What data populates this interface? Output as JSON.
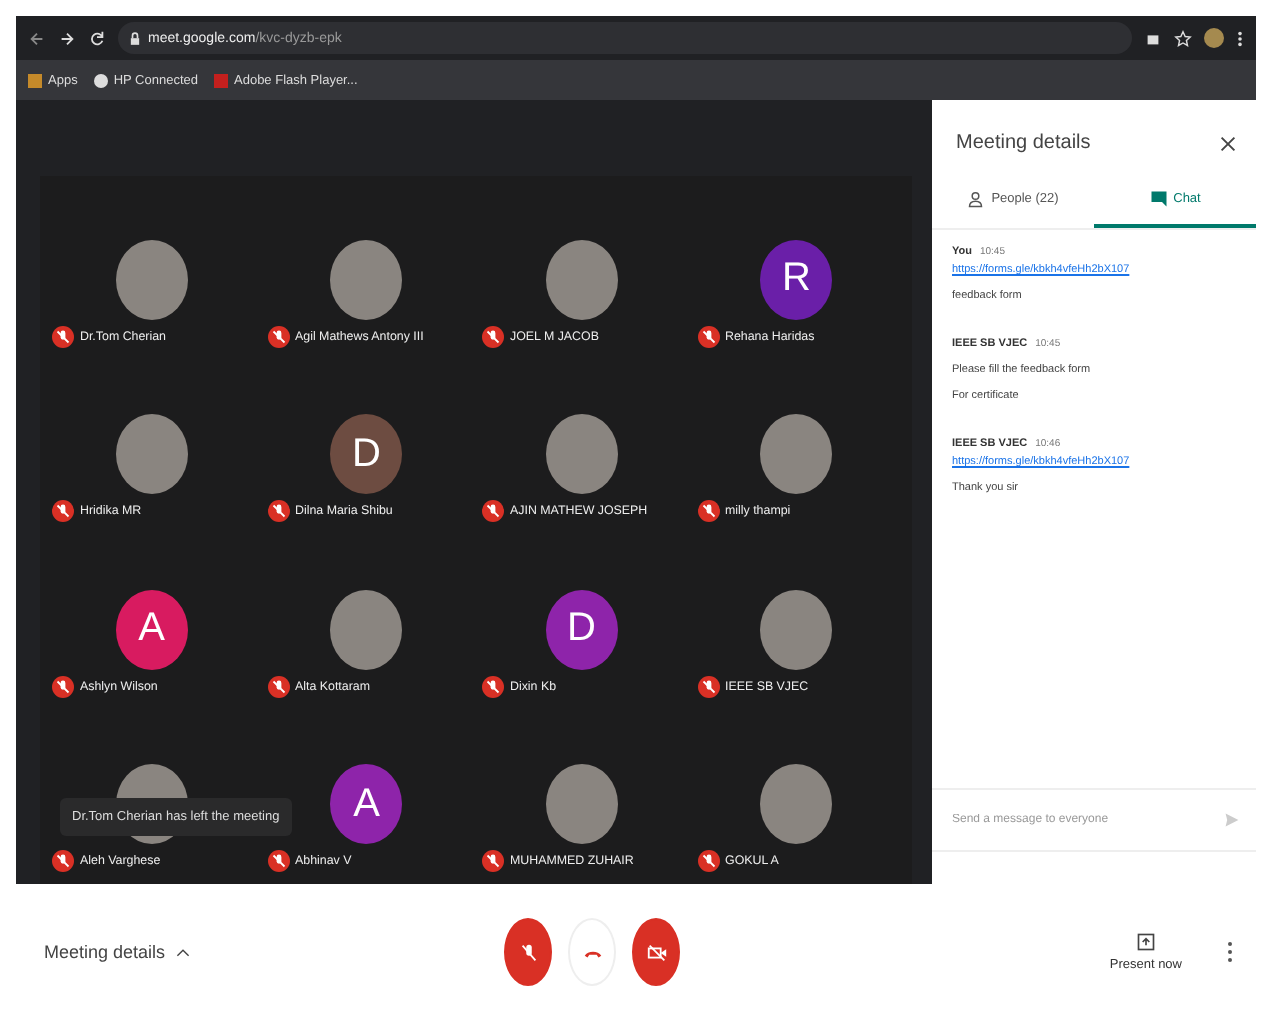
{
  "browser": {
    "url_host": "meet.google.com",
    "url_path": "/kvc-dyzb-epk",
    "bookmarks": [
      "Apps",
      "HP Connected",
      "Adobe Flash Player..."
    ]
  },
  "participants": [
    {
      "name": "Dr.Tom Cherian",
      "avatar": {
        "kind": "photo"
      }
    },
    {
      "name": "Agil Mathews Antony III",
      "avatar": {
        "kind": "photo"
      }
    },
    {
      "name": "JOEL M JACOB",
      "avatar": {
        "kind": "photo"
      }
    },
    {
      "name": "Rehana Haridas",
      "avatar": {
        "kind": "letter",
        "letter": "R",
        "color": "#6a1fa8"
      }
    },
    {
      "name": "Hridika MR",
      "avatar": {
        "kind": "photo"
      }
    },
    {
      "name": "Dilna Maria Shibu",
      "avatar": {
        "kind": "letter",
        "letter": "D",
        "color": "#6d4c41"
      }
    },
    {
      "name": "AJIN MATHEW JOSEPH",
      "avatar": {
        "kind": "photo"
      }
    },
    {
      "name": "milly thampi",
      "avatar": {
        "kind": "photo"
      }
    },
    {
      "name": "Ashlyn Wilson",
      "avatar": {
        "kind": "letter",
        "letter": "A",
        "color": "#d81b60"
      }
    },
    {
      "name": "Alta Kottaram",
      "avatar": {
        "kind": "photo"
      }
    },
    {
      "name": "Dixin Kb",
      "avatar": {
        "kind": "letter",
        "letter": "D",
        "color": "#8e24aa"
      }
    },
    {
      "name": "IEEE SB VJEC",
      "avatar": {
        "kind": "photo"
      }
    },
    {
      "name": "Aleh Varghese",
      "avatar": {
        "kind": "photo"
      }
    },
    {
      "name": "Abhinav V",
      "avatar": {
        "kind": "letter",
        "letter": "A",
        "color": "#8e24aa"
      }
    },
    {
      "name": "MUHAMMED ZUHAIR",
      "avatar": {
        "kind": "photo"
      }
    },
    {
      "name": "GOKUL A",
      "avatar": {
        "kind": "photo"
      }
    }
  ],
  "toast": "Dr.Tom Cherian has left the meeting",
  "panel": {
    "title": "Meeting details",
    "tabs": [
      {
        "label": "People (22)",
        "selected": false
      },
      {
        "label": "Chat",
        "selected": true
      }
    ],
    "messages": [
      {
        "sender": "You",
        "time": "10:45",
        "lines": [
          {
            "kind": "link",
            "text": "https://forms.gle/kbkh4vfeHh2bX107"
          },
          {
            "kind": "text",
            "text": "feedback form"
          }
        ]
      },
      {
        "sender": "IEEE SB VJEC",
        "time": "10:45",
        "lines": [
          {
            "kind": "text",
            "text": "Please fill the feedback form"
          },
          {
            "kind": "text",
            "text": "For certificate"
          }
        ]
      },
      {
        "sender": "IEEE SB VJEC",
        "time": "10:46",
        "lines": [
          {
            "kind": "link",
            "text": "https://forms.gle/kbkh4vfeHh2bX107"
          },
          {
            "kind": "text",
            "text": "Thank you sir"
          }
        ]
      }
    ],
    "input": {
      "placeholder": "Send a message to everyone"
    }
  },
  "bottom_bar": {
    "details_label": "Meeting details",
    "mic_muted": true,
    "camera_off": true,
    "present_label": "Present now"
  }
}
